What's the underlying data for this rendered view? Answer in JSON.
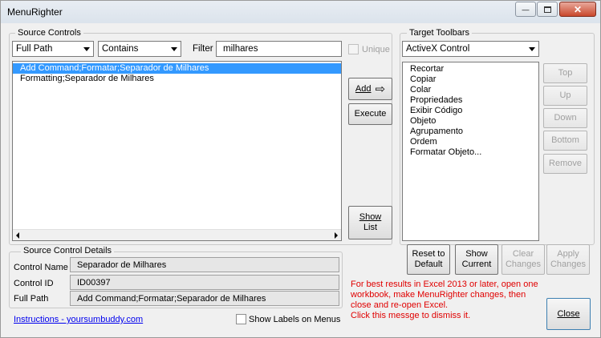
{
  "window": {
    "title": "MenuRighter",
    "minimize_glyph": "—",
    "restore_glyph": "▫",
    "close_glyph": "✕"
  },
  "source_controls": {
    "label": "Source Controls",
    "path_combo": "Full Path",
    "match_combo": "Contains",
    "filter_label": "Filter",
    "filter_value": "milhares",
    "unique_label": "Unique",
    "items": [
      "Add Command;Formatar;Separador de Milhares",
      "Formatting;Separador de Milhares"
    ],
    "selected_index": 0
  },
  "actions": {
    "add_label": "Add",
    "add_arrow": "⇨",
    "execute_label": "Execute",
    "show_list_line1": "Show",
    "show_list_line2": "List"
  },
  "target_toolbars": {
    "label": "Target Toolbars",
    "combo": "ActiveX Control",
    "items": [
      "Recortar",
      "Copiar",
      "Colar",
      "Propriedades",
      "Exibir Código",
      "Objeto",
      "Agrupamento",
      "Ordem",
      "Formatar Objeto..."
    ]
  },
  "move_buttons": {
    "top": "Top",
    "up": "Up",
    "down": "Down",
    "bottom": "Bottom",
    "remove": "Remove"
  },
  "details": {
    "label": "Source Control Details",
    "name_label": "Control Name",
    "name_value": "Separador de Milhares",
    "id_label": "Control ID",
    "id_value": "ID00397",
    "path_label": "Full Path",
    "path_value": "Add Command;Formatar;Separador de Milhares"
  },
  "bottom_buttons": {
    "reset_line1": "Reset to",
    "reset_line2": "Default",
    "show_current_line1": "Show",
    "show_current_line2": "Current",
    "clear_line1": "Clear",
    "clear_line2": "Changes",
    "apply_line1": "Apply",
    "apply_line2": "Changes",
    "close": "Close"
  },
  "footer": {
    "link": "Instructions - yoursumbuddy.com",
    "show_labels": "Show Labels on Menus",
    "message_lines": [
      "For best results in Excel 2013 or later, open one",
      "workbook, make MenuRighter changes, then",
      "close and re-open Excel.",
      "Click this messge to dismiss it."
    ]
  }
}
